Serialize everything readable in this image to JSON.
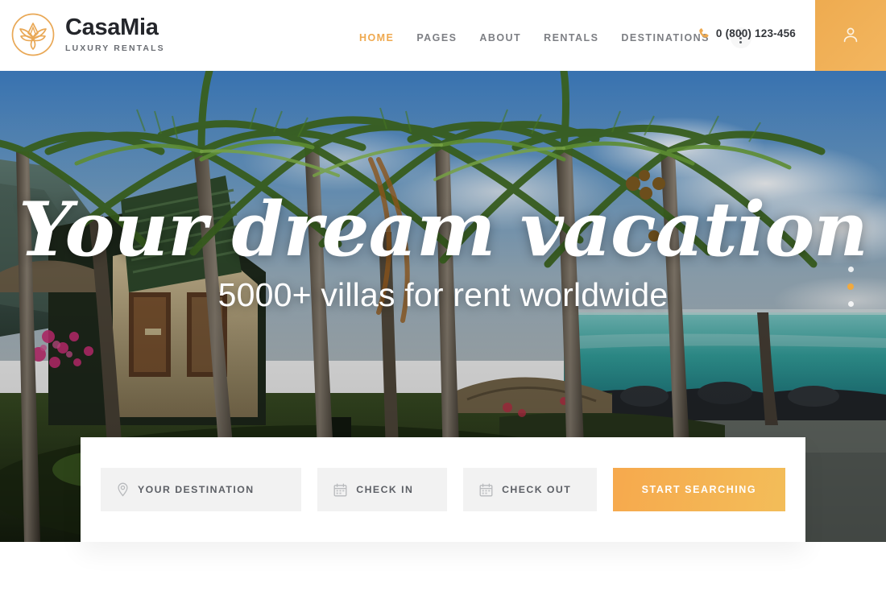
{
  "header": {
    "brand": {
      "name": "CasaMia",
      "tagline": "LUXURY RENTALS",
      "logo_icon": "lotus-flower-circle-icon",
      "accent_color": "#e9a856"
    },
    "nav": [
      {
        "label": "HOME",
        "active": true
      },
      {
        "label": "PAGES",
        "active": false
      },
      {
        "label": "ABOUT",
        "active": false
      },
      {
        "label": "RENTALS",
        "active": false
      },
      {
        "label": "DESTINATIONS",
        "active": false
      }
    ],
    "more_menu_icon": "three-dots-vertical-icon",
    "phone": {
      "icon": "phone-icon",
      "number": "0 (800) 123-456"
    },
    "account": {
      "icon": "user-account-icon",
      "background_color": "#eeab50"
    }
  },
  "hero": {
    "title": "Your dream vacation",
    "subtitle": "5000+ villas for rent worldwide",
    "slider": {
      "count": 3,
      "active_index": 1,
      "active_color": "#f0a93f"
    }
  },
  "search": {
    "destination": {
      "icon": "map-pin-icon",
      "placeholder": "YOUR DESTINATION",
      "value": ""
    },
    "check_in": {
      "icon": "calendar-icon",
      "placeholder": "CHECK IN",
      "value": ""
    },
    "check_out": {
      "icon": "calendar-icon",
      "placeholder": "CHECK OUT",
      "value": ""
    },
    "submit_label": "START SEARCHING",
    "submit_color": "#f6a94d"
  }
}
